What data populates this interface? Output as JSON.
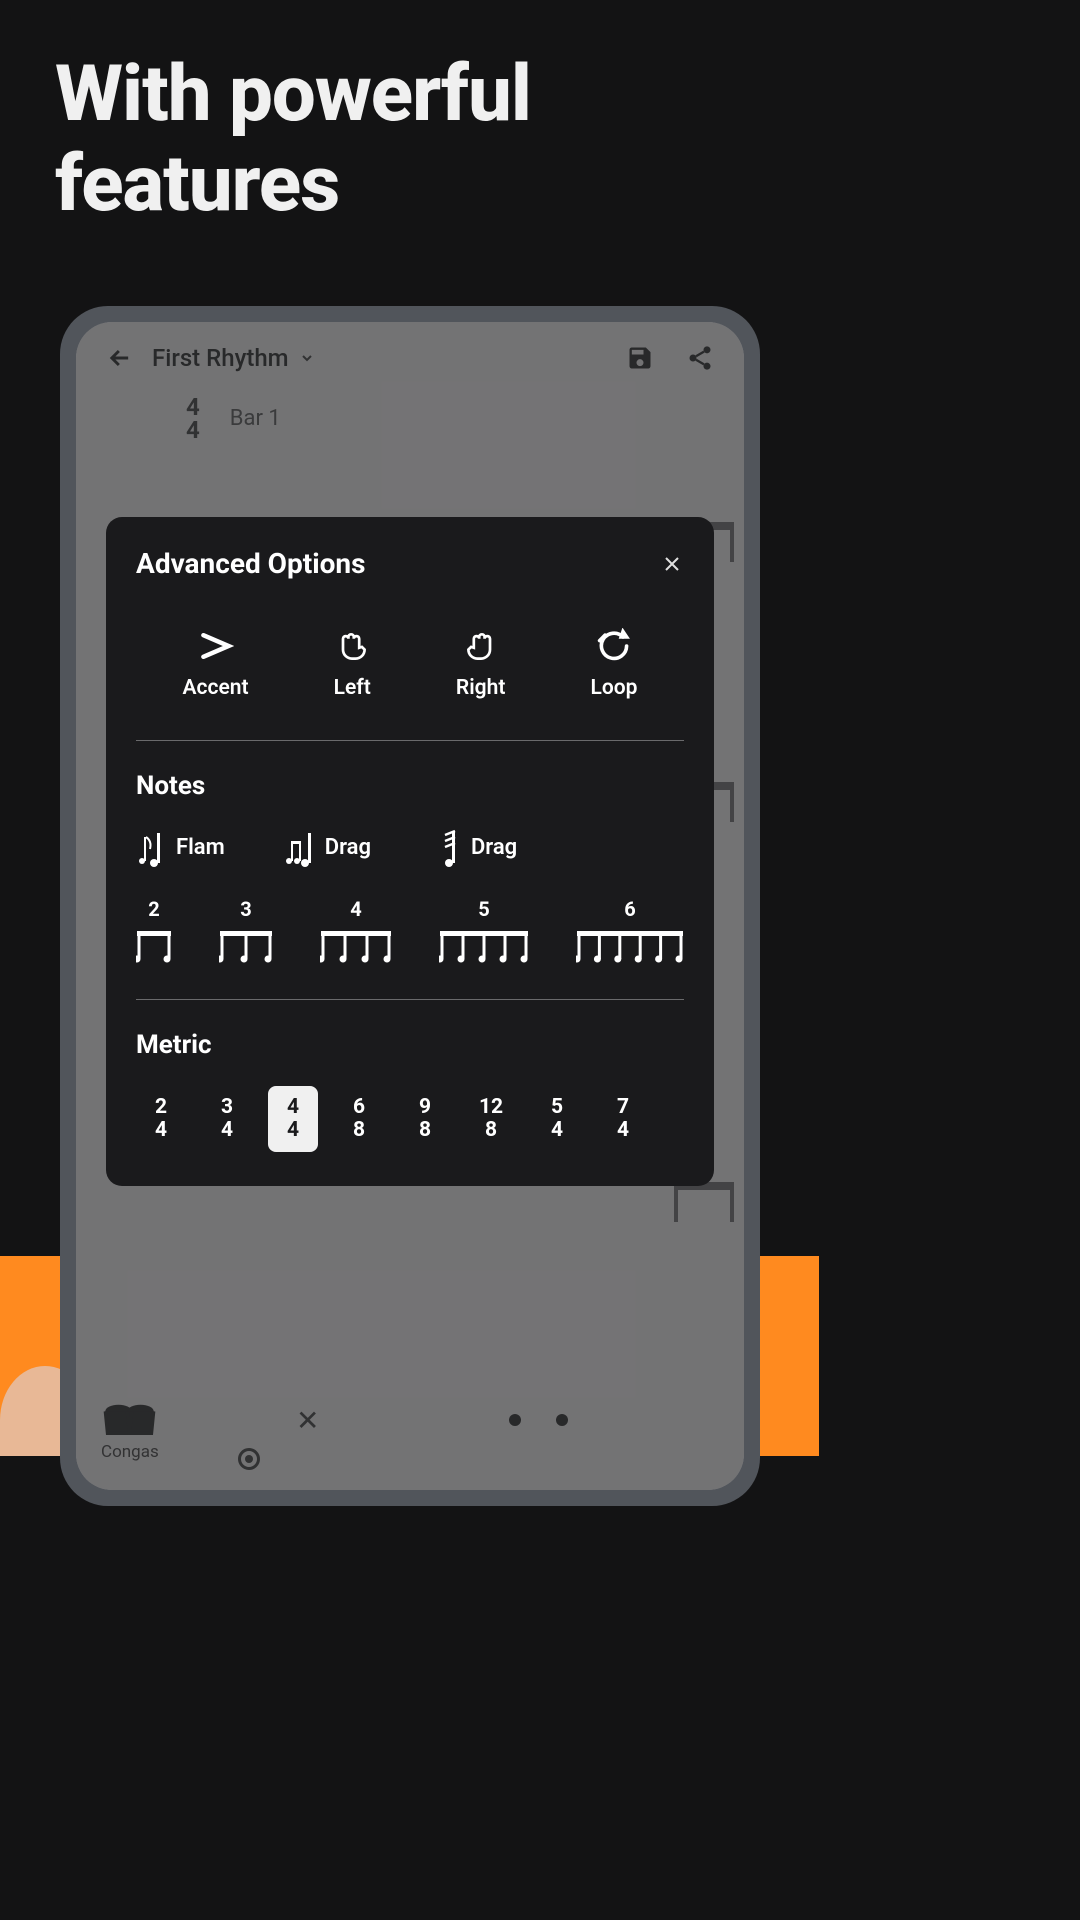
{
  "headline": "With powerful features",
  "app": {
    "title": "First Rhythm",
    "time_signature_top": "4",
    "time_signature_bottom": "4",
    "bar_label": "Bar 1",
    "track_name": "Congas"
  },
  "modal": {
    "title": "Advanced Options",
    "options": [
      {
        "name": "accent",
        "label": "Accent"
      },
      {
        "name": "left",
        "label": "Left"
      },
      {
        "name": "right",
        "label": "Right"
      },
      {
        "name": "loop",
        "label": "Loop"
      }
    ],
    "notes_title": "Notes",
    "note_types": [
      {
        "name": "flam",
        "label": "Flam"
      },
      {
        "name": "drag",
        "label": "Drag"
      },
      {
        "name": "drag2",
        "label": "Drag"
      }
    ],
    "tuplets": [
      2,
      3,
      4,
      5,
      6
    ],
    "metric_title": "Metric",
    "metrics": [
      {
        "top": "2",
        "bottom": "4",
        "selected": false
      },
      {
        "top": "3",
        "bottom": "4",
        "selected": false
      },
      {
        "top": "4",
        "bottom": "4",
        "selected": true
      },
      {
        "top": "6",
        "bottom": "8",
        "selected": false
      },
      {
        "top": "9",
        "bottom": "8",
        "selected": false
      },
      {
        "top": "12",
        "bottom": "8",
        "selected": false
      },
      {
        "top": "5",
        "bottom": "4",
        "selected": false
      },
      {
        "top": "7",
        "bottom": "4",
        "selected": false
      }
    ]
  }
}
